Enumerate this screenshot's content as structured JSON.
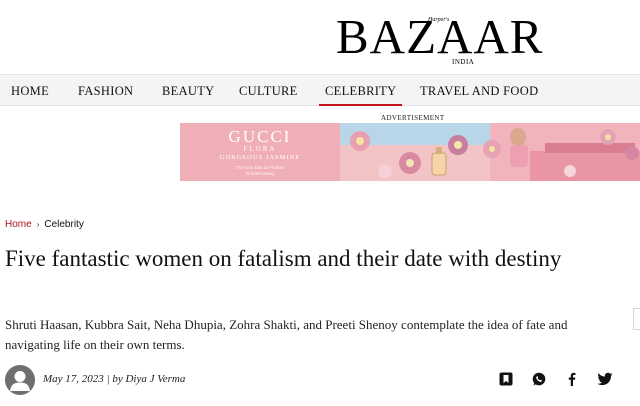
{
  "header": {
    "logo": {
      "harpers": "Harper's",
      "word": "BAZAAR",
      "edition": "INDIA"
    }
  },
  "nav": {
    "items": [
      {
        "label": "HOME"
      },
      {
        "label": "FASHION"
      },
      {
        "label": "BEAUTY"
      },
      {
        "label": "CULTURE"
      },
      {
        "label": "CELEBRITY",
        "active": true
      },
      {
        "label": "TRAVEL AND FOOD"
      }
    ]
  },
  "ad": {
    "label": "ADVERTISEMENT",
    "brand": "GUCCI",
    "product": "FLORA",
    "variant": "GORGEOUS JASMINE",
    "tagline_1": "The New Eau de Parfum",
    "tagline_2": "#FloraFantasy"
  },
  "breadcrumb": {
    "home": "Home",
    "separator": "›",
    "current": "Celebrity"
  },
  "article": {
    "headline": "Five fantastic women on fatalism and their date with destiny",
    "standfirst": "Shruti Haasan, Kubbra Sait, Neha Dhupia, Zohra Shakti, and Preeti Shenoy contemplate the idea of fate and navigating life on their own terms.",
    "date": "May 17, 2023",
    "by_prefix": " | by ",
    "author": "Diya J Verma"
  },
  "share": {
    "icons": [
      "bookmark-icon",
      "whatsapp-icon",
      "facebook-icon",
      "twitter-icon"
    ]
  },
  "colors": {
    "accent": "#c0141b",
    "nav_bg": "#f4f4f4",
    "ad_pink": "#f0aeb6"
  }
}
